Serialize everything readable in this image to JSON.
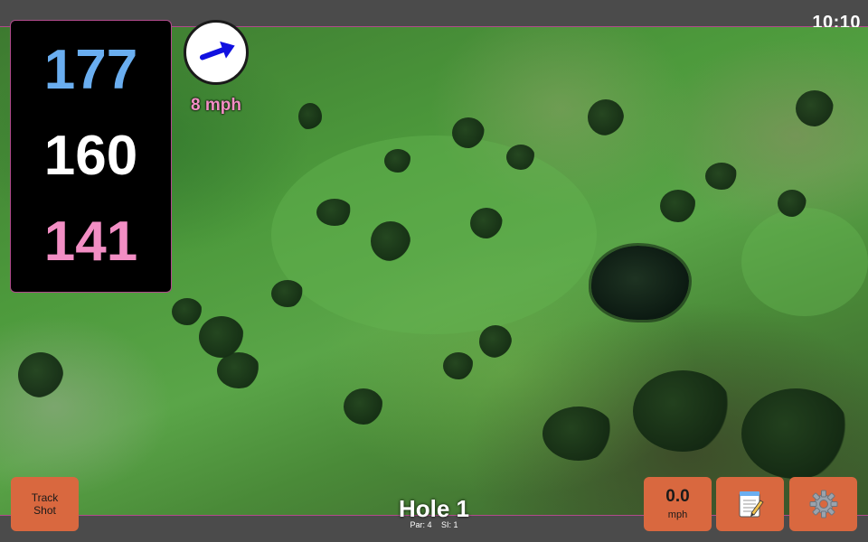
{
  "status_bar": {
    "time": "10:10"
  },
  "distances": {
    "back": "177",
    "middle": "160",
    "front": "141"
  },
  "wind": {
    "speed": "8 mph",
    "direction": "east-northeast",
    "arrow_color": "#1010e0"
  },
  "hole": {
    "title": "Hole 1",
    "par": "Par: 4",
    "stroke_index": "SI: 1"
  },
  "buttons": {
    "track_shot_line1": "Track",
    "track_shot_line2": "Shot",
    "speed_value": "0.0",
    "speed_unit": "mph",
    "notes_icon": "notepad-icon",
    "settings_icon": "gear-icon"
  },
  "colors": {
    "back_distance": "#6aaef0",
    "middle_distance": "#ffffff",
    "front_distance": "#f28ec4",
    "button_bg": "#d9683f",
    "accent_border": "#b04a8c"
  }
}
